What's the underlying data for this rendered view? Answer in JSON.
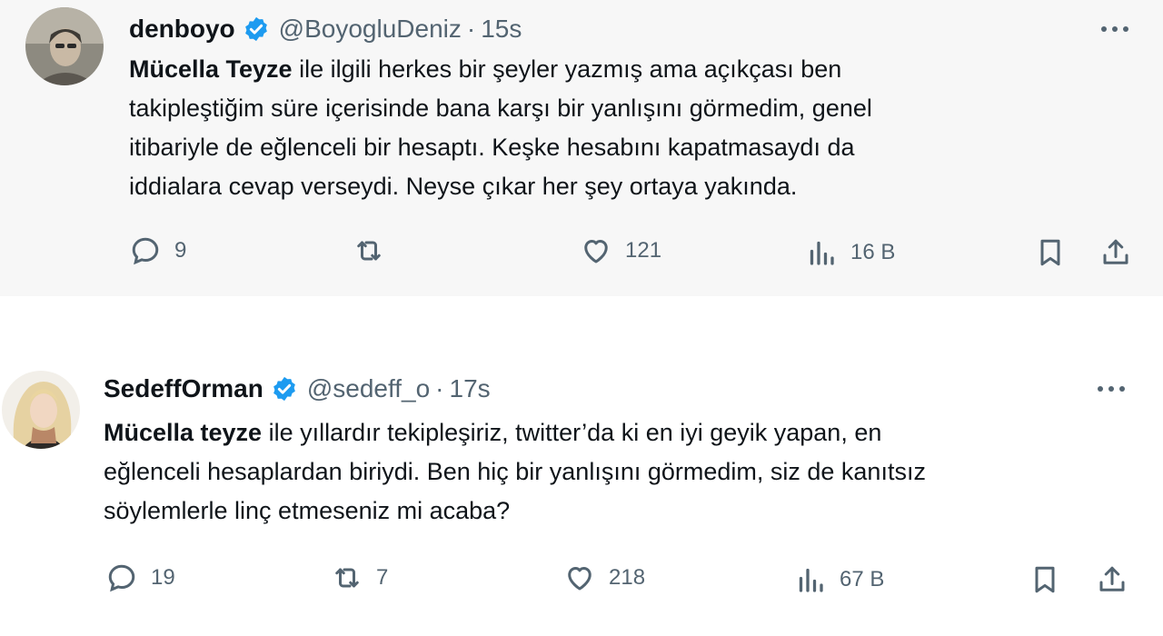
{
  "tweets": [
    {
      "display_name": "denboyo",
      "handle": "@BoyogluDeniz",
      "separator": "·",
      "time": "15s",
      "text_bold": "Mücella Teyze",
      "text_line1_rest": " ile ilgili herkes bir şeyler yazmış ama açıkçası ben",
      "text_line2": "takipleştiğim süre içerisinde bana karşı bir yanlışını görmedim, genel",
      "text_line3": "itibariyle de eğlenceli bir hesaptı. Keşke hesabını kapatmasaydı da",
      "text_line4": "iddialara cevap verseydi. Neyse çıkar her şey ortaya yakında.",
      "replies": "9",
      "retweets": "",
      "likes": "121",
      "views": "16 B"
    },
    {
      "display_name": "SedeffOrman",
      "handle": "@sedeff_o",
      "separator": "·",
      "time": "17s",
      "text_bold": "Mücella teyze",
      "text_line1_rest": " ile yıllardır tekipleşiriz, twitter’da ki en iyi geyik yapan, en",
      "text_line2": "eğlenceli hesaplardan biriydi. Ben hiç bir yanlışını görmedim, siz de kanıtsız",
      "text_line3": "söylemlerle linç etmeseniz mi acaba?",
      "text_line4": "",
      "replies": "19",
      "retweets": "7",
      "likes": "218",
      "views": "67 B"
    }
  ],
  "icons": {
    "verified": "verified-badge-icon",
    "reply": "reply-icon",
    "retweet": "retweet-icon",
    "like": "heart-icon",
    "views": "views-chart-icon",
    "bookmark": "bookmark-icon",
    "share": "share-icon",
    "more": "more-options-icon"
  },
  "colors": {
    "verified": "#1d9bf0",
    "icon_gray": "#536471",
    "text": "#0f1419"
  }
}
